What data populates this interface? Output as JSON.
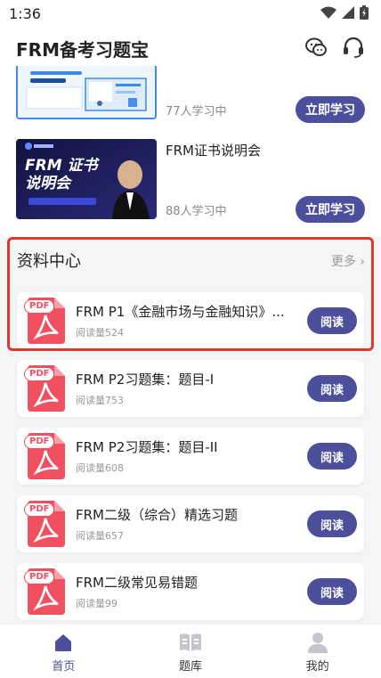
{
  "status_bar": {
    "time": "1:36"
  },
  "header": {
    "title": "FRM备考习题宝"
  },
  "courses": [
    {
      "title": "",
      "learners": "77人学习中",
      "button": "立即学习",
      "thumb_text": ""
    },
    {
      "title": "FRM证书说明会",
      "learners": "88人学习中",
      "button": "立即学习",
      "thumb_text": "FRM 证书说明会"
    }
  ],
  "materials": {
    "title": "资料中心",
    "more": "更多",
    "pdf_badge": "PDF",
    "items": [
      {
        "name": "FRM P1《金融市场与金融知识》...",
        "reads": "阅读量524",
        "button": "阅读"
      },
      {
        "name": "FRM P2习题集：题目-I",
        "reads": "阅读量753",
        "button": "阅读"
      },
      {
        "name": "FRM P2习题集：题目-II",
        "reads": "阅读量608",
        "button": "阅读"
      },
      {
        "name": "FRM二级（综合）精选习题",
        "reads": "阅读量657",
        "button": "阅读"
      },
      {
        "name": "FRM二级常见易错题",
        "reads": "阅读量99",
        "button": "阅读"
      }
    ]
  },
  "bottom_nav": [
    {
      "label": "首页",
      "active": true
    },
    {
      "label": "题库",
      "active": false
    },
    {
      "label": "我的",
      "active": false
    }
  ],
  "colors": {
    "accent": "#4b4f9c",
    "highlight_border": "#e0392b",
    "pdf_red": "#f0505f"
  }
}
